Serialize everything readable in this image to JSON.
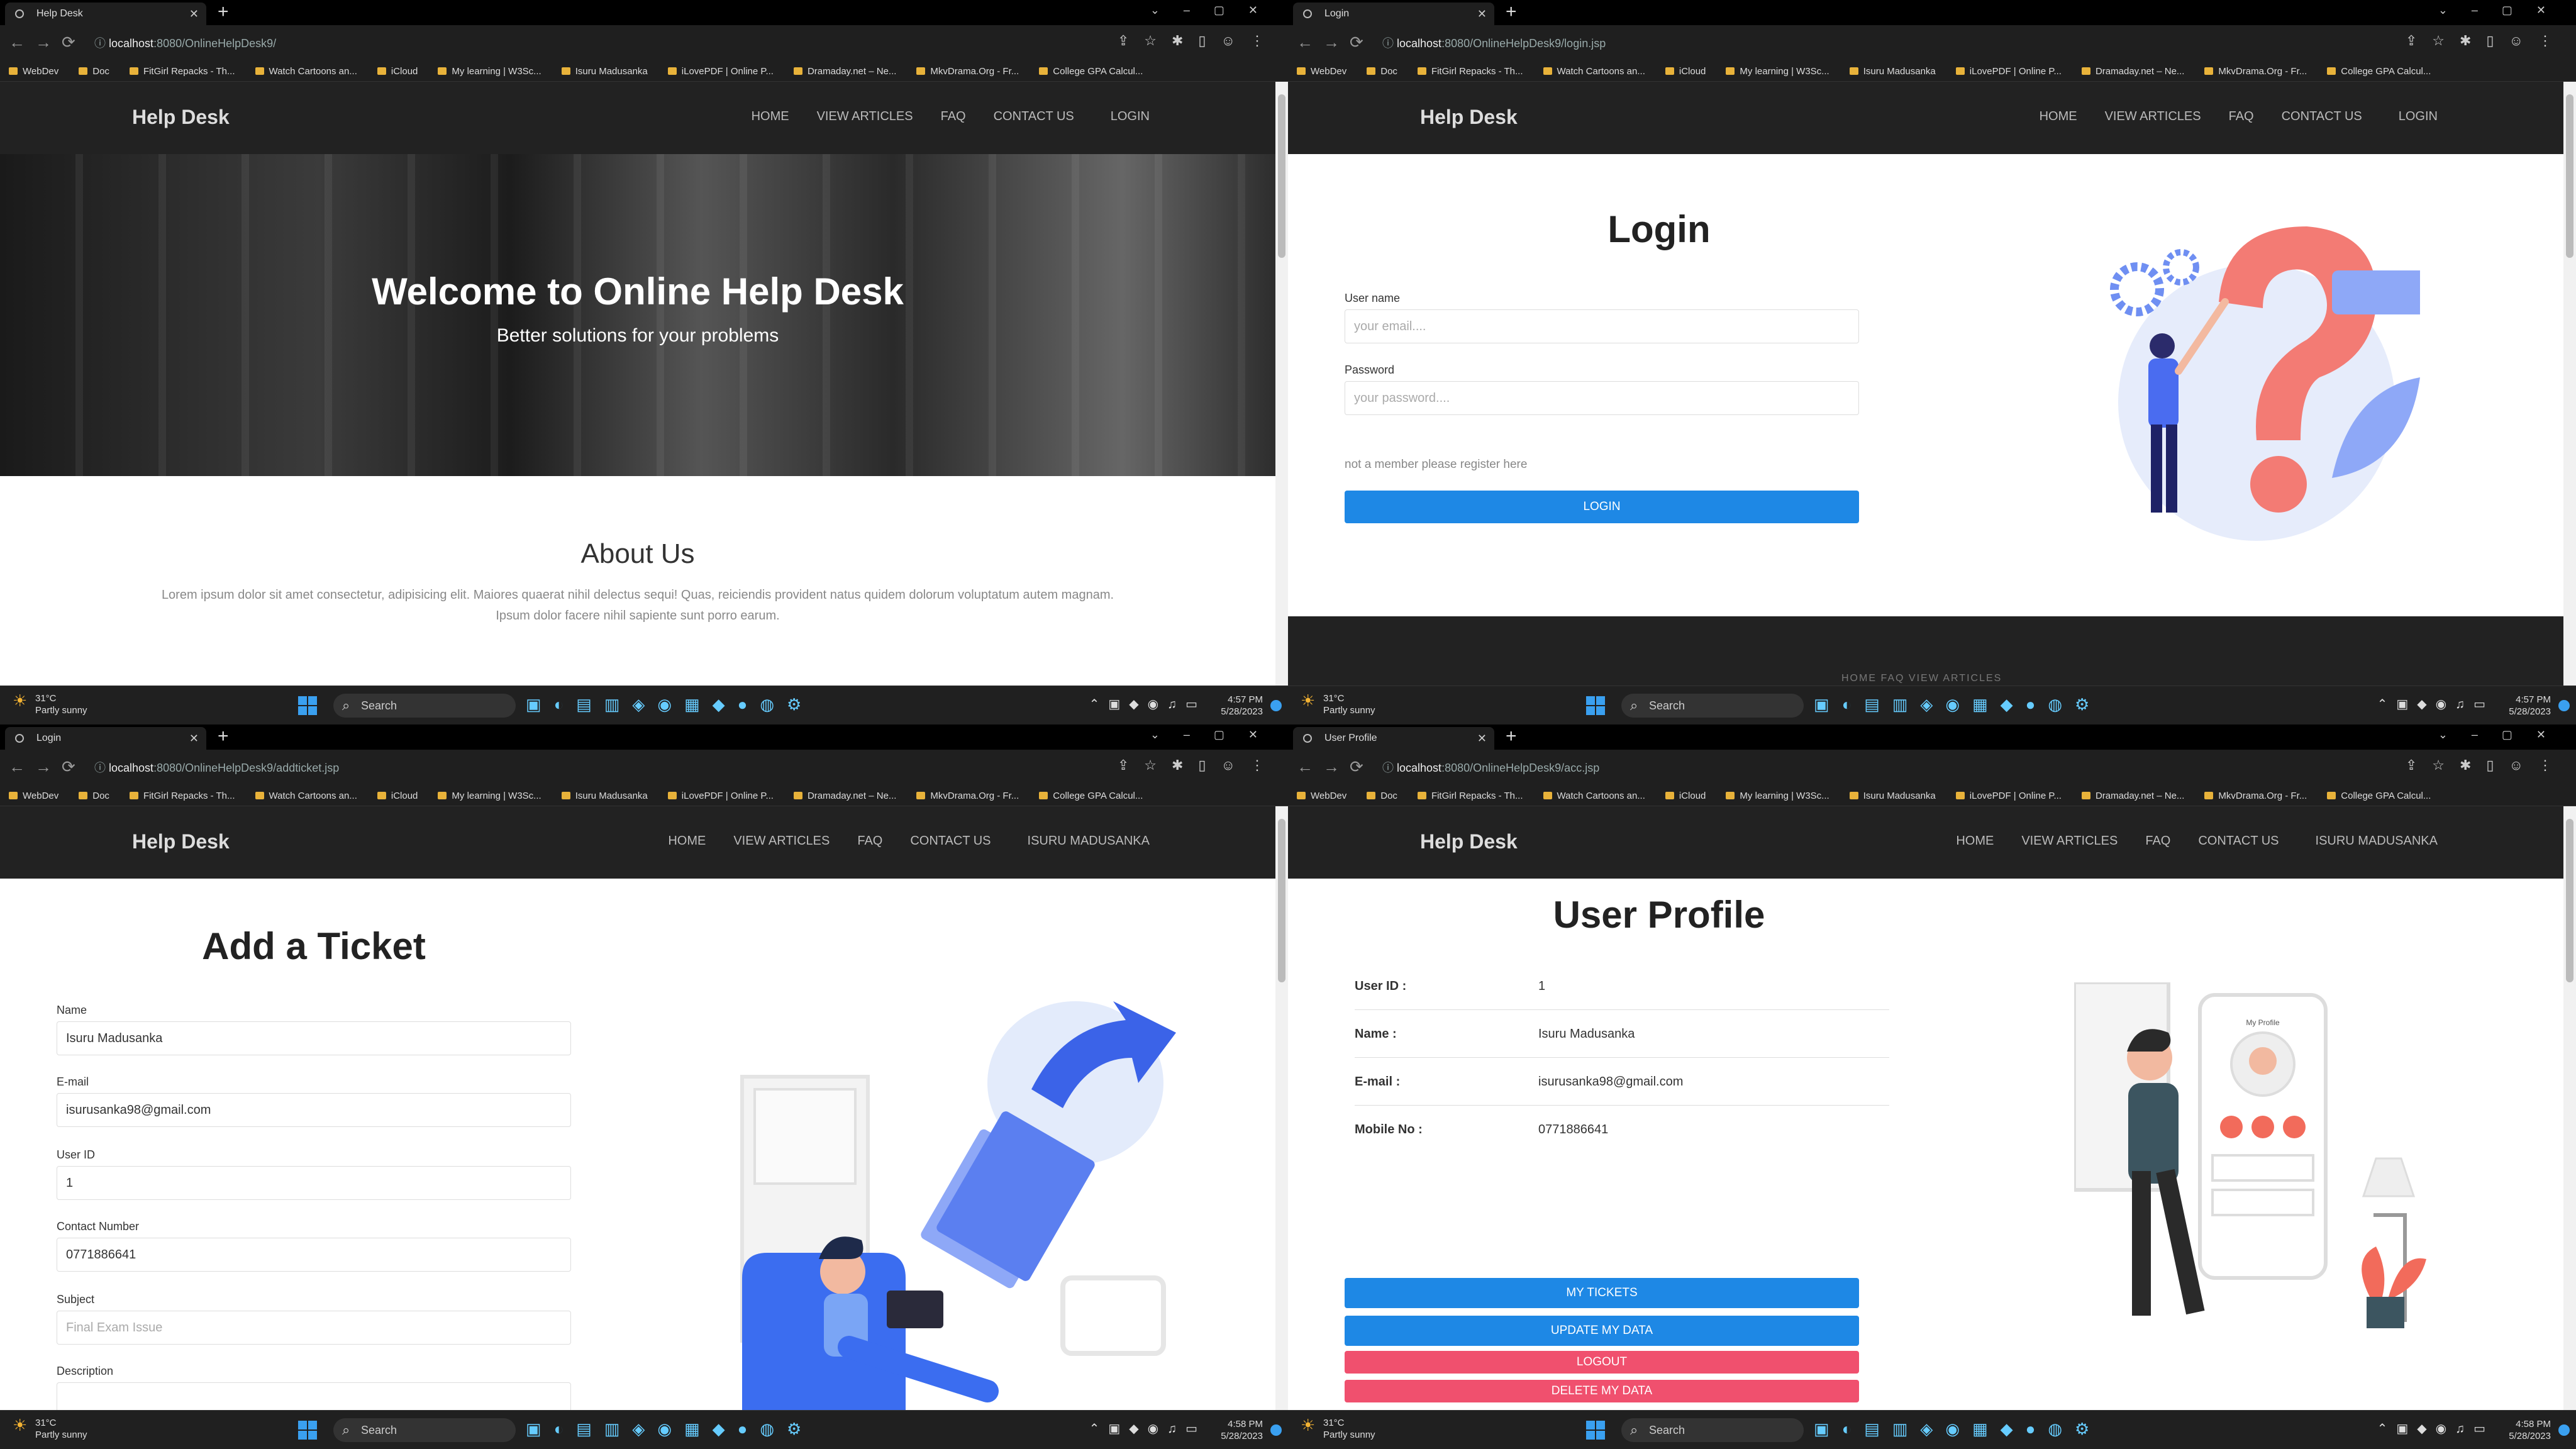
{
  "windows": [
    {
      "tab_title": "Help Desk",
      "url_host": "localhost",
      "url_path": ":8080/OnlineHelpDesk9/",
      "nav_last": "LOGIN",
      "page": {
        "hero_title": "Welcome to Online Help Desk",
        "hero_subtitle": "Better solutions for your problems",
        "about_title": "About Us",
        "about_text": "Lorem ipsum dolor sit amet consectetur, adipisicing elit. Maiores quaerat nihil delectus sequi! Quas, reiciendis provident natus quidem dolorum voluptatum autem magnam. Ipsum dolor facere nihil sapiente sunt porro earum."
      },
      "clock": {
        "time": "4:57 PM",
        "date": "5/28/2023"
      }
    },
    {
      "tab_title": "Login",
      "url_host": "localhost",
      "url_path": ":8080/OnlineHelpDesk9/login.jsp",
      "nav_last": "LOGIN",
      "page": {
        "title": "Login",
        "username_label": "User name",
        "username_placeholder": "your email....",
        "password_label": "Password",
        "password_placeholder": "your password....",
        "register_link": "not a member please register here",
        "login_button": "LOGIN",
        "footer_links": "HOME    FAQ    VIEW ARTICLES"
      },
      "clock": {
        "time": "4:57 PM",
        "date": "5/28/2023"
      }
    },
    {
      "tab_title": "Login",
      "url_host": "localhost",
      "url_path": ":8080/OnlineHelpDesk9/addticket.jsp",
      "nav_last": "ISURU MADUSANKA",
      "page": {
        "title": "Add a Ticket",
        "name_label": "Name",
        "name_value": "Isuru Madusanka",
        "email_label": "E-mail",
        "email_value": "isurusanka98@gmail.com",
        "userid_label": "User ID",
        "userid_value": "1",
        "contact_label": "Contact Number",
        "contact_value": "0771886641",
        "subject_label": "Subject",
        "subject_placeholder": "Final Exam Issue",
        "description_label": "Description"
      },
      "clock": {
        "time": "4:58 PM",
        "date": "5/28/2023"
      }
    },
    {
      "tab_title": "User Profile",
      "url_host": "localhost",
      "url_path": ":8080/OnlineHelpDesk9/acc.jsp",
      "nav_last": "ISURU MADUSANKA",
      "page": {
        "title": "User Profile",
        "rows": [
          {
            "label": "User ID :",
            "value": "1"
          },
          {
            "label": "Name :",
            "value": "Isuru Madusanka"
          },
          {
            "label": "E-mail :",
            "value": "isurusanka98@gmail.com"
          },
          {
            "label": "Mobile No :",
            "value": "0771886641"
          }
        ],
        "my_tickets_button": "MY TICKETS",
        "update_button": "UPDATE MY DATA",
        "logout_button": "LOGOUT",
        "delete_button": "DELETE MY DATA",
        "illustration_label": "My Profile"
      },
      "clock": {
        "time": "4:58 PM",
        "date": "5/28/2023"
      }
    }
  ],
  "site": {
    "brand": "Help Desk",
    "menu": [
      "HOME",
      "VIEW ARTICLES",
      "FAQ",
      "CONTACT US"
    ]
  },
  "bookmarks": [
    "WebDev",
    "Doc",
    "FitGirl Repacks - Th...",
    "Watch Cartoons an...",
    "iCloud",
    "My learning | W3Sc...",
    "Isuru Madusanka",
    "iLovePDF | Online P...",
    "Dramaday.net – Ne...",
    "MkvDrama.Org - Fr...",
    "College GPA Calcul..."
  ],
  "taskbar": {
    "temp": "31°C",
    "condition": "Partly sunny",
    "search": "Search"
  },
  "colors": {
    "nav_bg": "#222222",
    "primary": "#1e88e5",
    "danger": "#f0506e"
  }
}
